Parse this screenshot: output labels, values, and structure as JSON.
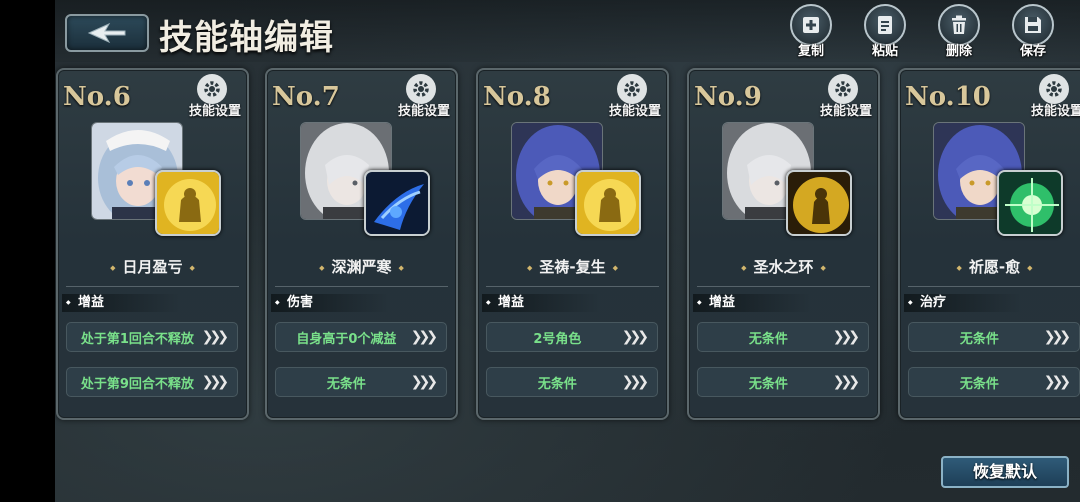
{
  "header": {
    "title": "技能轴编辑",
    "back_icon": "back-arrow-icon"
  },
  "toolbar": [
    {
      "label": "复制",
      "icon": "copy-icon"
    },
    {
      "label": "粘贴",
      "icon": "paste-icon"
    },
    {
      "label": "删除",
      "icon": "trash-icon"
    },
    {
      "label": "保存",
      "icon": "save-icon"
    }
  ],
  "cards": [
    {
      "no": "No.6",
      "settings_label": "技能设置",
      "skill_name": "日月盈亏",
      "category": "增益",
      "conditions": [
        "处于第1回合不释放",
        "处于第9回合不释放"
      ],
      "portrait": "maid-silver-hair",
      "skill_icon": "golden-knight-icon"
    },
    {
      "no": "No.7",
      "settings_label": "技能设置",
      "skill_name": "深渊严寒",
      "category": "伤害",
      "conditions": [
        "自身高于0个减益",
        "无条件"
      ],
      "portrait": "white-hair-veiled",
      "skill_icon": "blue-ice-claw-icon"
    },
    {
      "no": "No.8",
      "settings_label": "技能设置",
      "skill_name": "圣祷-复生",
      "category": "增益",
      "conditions": [
        "2号角色",
        "无条件"
      ],
      "portrait": "blue-hair-nun",
      "skill_icon": "golden-knight-icon"
    },
    {
      "no": "No.9",
      "settings_label": "技能设置",
      "skill_name": "圣水之环",
      "category": "增益",
      "conditions": [
        "无条件",
        "无条件"
      ],
      "portrait": "white-hair-veiled",
      "skill_icon": "golden-warrior-icon"
    },
    {
      "no": "No.10",
      "settings_label": "技能设置",
      "skill_name": "祈愿-愈",
      "category": "治疗",
      "conditions": [
        "无条件",
        "无条件"
      ],
      "portrait": "blue-hair-nun",
      "skill_icon": "green-heal-orb-icon"
    }
  ],
  "footer": {
    "restore_label": "恢复默认"
  },
  "colors": {
    "condition_text": "#79e08a",
    "card_number": "#d8c79b",
    "accent_gold": "#d2b66d"
  }
}
